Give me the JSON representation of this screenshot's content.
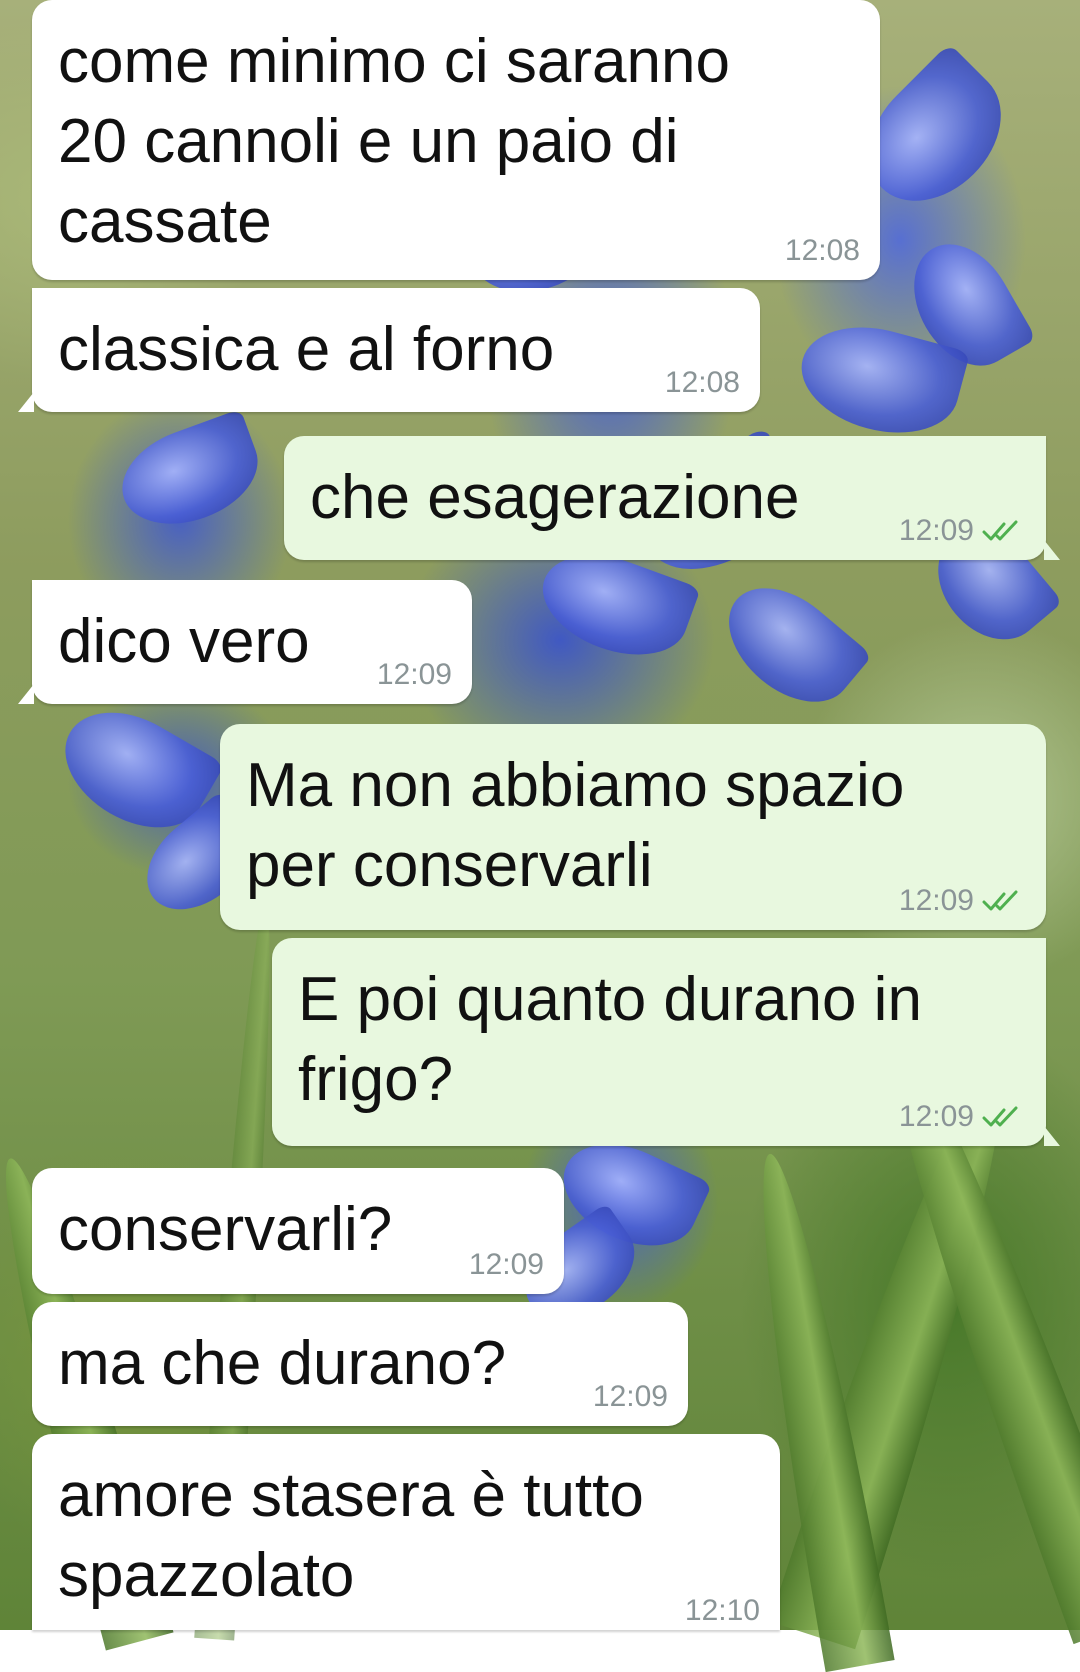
{
  "conversation": {
    "wallpaper": "blue-hyacinth-flowers",
    "colors": {
      "incoming_bubble": "#ffffff",
      "outgoing_bubble": "#e8f8df",
      "read_checks": "#4fb04f",
      "timestamp": "#8a9496"
    },
    "messages": [
      {
        "direction": "in",
        "text": "come minimo ci saranno\n20 cannoli e un paio di\ncassate",
        "time": "12:08"
      },
      {
        "direction": "in",
        "text": "classica e al forno",
        "time": "12:08"
      },
      {
        "direction": "out",
        "text": "che esagerazione",
        "time": "12:09",
        "status_icon": "double-check-read-icon"
      },
      {
        "direction": "in",
        "text": "dico vero",
        "time": "12:09"
      },
      {
        "direction": "out",
        "text": "Ma non abbiamo spazio\nper conservarli",
        "time": "12:09",
        "status_icon": "double-check-read-icon"
      },
      {
        "direction": "out",
        "text": "E poi quanto durano in\nfrigo?",
        "time": "12:09",
        "status_icon": "double-check-read-icon"
      },
      {
        "direction": "in",
        "text": "conservarli?",
        "time": "12:09"
      },
      {
        "direction": "in",
        "text": "ma che durano?",
        "time": "12:09"
      },
      {
        "direction": "in",
        "text": "amore stasera è tutto\nspazzolato",
        "time": "12:10"
      }
    ]
  }
}
